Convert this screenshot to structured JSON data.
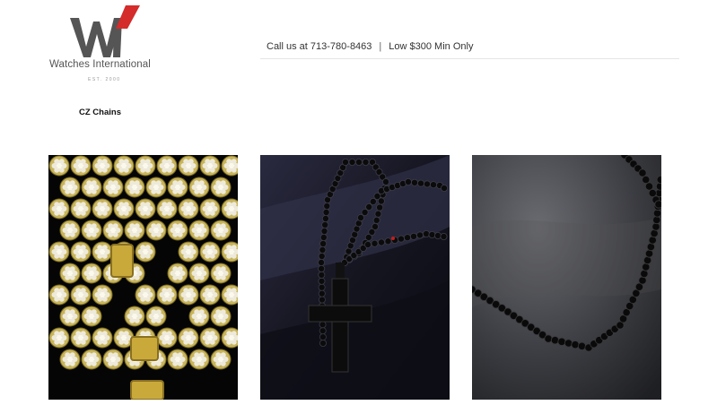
{
  "logo": {
    "brand": "Watches International",
    "est": "EST. 2000"
  },
  "header": {
    "phone_text": "Call us at 713-780-8463",
    "separator": "|",
    "min_order_text": "Low $300 Min Only"
  },
  "category": {
    "title": "CZ Chains"
  },
  "products": [
    {
      "image": "gold-iced-cluster-chain",
      "palette": [
        "#050505",
        "#c8b45a",
        "#e8e4d2"
      ]
    },
    {
      "image": "black-cz-cross-chain",
      "palette": [
        "#1a1a2a",
        "#0a0a0a",
        "#3a3a50"
      ]
    },
    {
      "image": "black-cz-tennis-chain",
      "palette": [
        "#2f3034",
        "#0c0c0c",
        "#55565c"
      ]
    }
  ],
  "colors": {
    "logo_gray": "#555555",
    "logo_red": "#d42b2b"
  }
}
